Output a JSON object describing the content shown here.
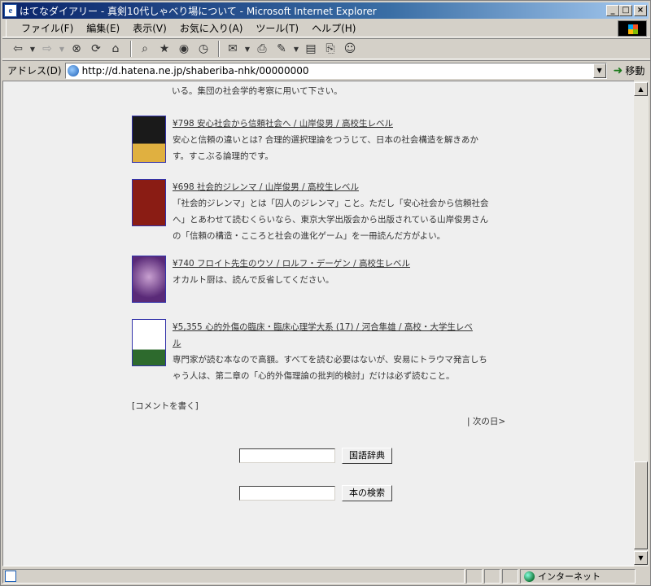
{
  "window": {
    "title": "はてなダイアリー - 真剣10代しゃべり場について - Microsoft Internet Explorer",
    "buttons": {
      "minimize": "_",
      "maximize": "□",
      "close": "×"
    }
  },
  "menu": [
    "ファイル(F)",
    "編集(E)",
    "表示(V)",
    "お気に入り(A)",
    "ツール(T)",
    "ヘルプ(H)"
  ],
  "toolbar": {
    "icons": [
      "back-icon",
      "forward-icon",
      "stop-icon",
      "refresh-icon",
      "home-icon",
      "search-icon",
      "favorites-icon",
      "media-icon",
      "history-icon",
      "mail-icon",
      "print-icon",
      "edit-icon",
      "discuss-icon",
      "messenger-icon"
    ]
  },
  "address": {
    "label": "アドレス(D)",
    "url": "http://d.hatena.ne.jp/shaberiba-nhk/00000000",
    "go_label": "移動"
  },
  "content": {
    "top_tail": "いる。集団の社会学的考察に用いて下さい。",
    "books": [
      {
        "title": "¥798 安心社会から信頼社会へ / 山岸俊男 / 高校生レベル",
        "desc_lines": [
          "安心と信頼の違いとは? 合理的選択理論をつうじて、日本の社会構造を解きあか",
          "す。すこぶる論理的です。"
        ]
      },
      {
        "title": "¥698 社会的ジレンマ / 山岸俊男 / 高校生レベル",
        "desc_lines": [
          "「社会的ジレンマ」とは「囚人のジレンマ」こと。ただし「安心社会から信頼社会",
          "へ」とあわせて読むくらいなら、東京大学出版会から出版されている山岸俊男さん",
          "の「信頼の構造・こころと社会の進化ゲーム」を一冊読んだ方がよい。"
        ]
      },
      {
        "title": "¥740 フロイト先生のウソ / ロルフ・デーゲン / 高校生レベル",
        "desc_lines": [
          "オカルト厨は、読んで反省してください。"
        ]
      },
      {
        "title_lines": [
          "¥5,355 心的外傷の臨床・臨床心理学大系 (17) / 河合隼雄 / 高校・大学生レベ",
          "ル"
        ],
        "desc_lines": [
          "専門家が読む本なので高額。すべてを読む必要はないが、安易にトラウマ発言しち",
          "ゃう人は、第二章の「心的外傷理論の批判的検討」だけは必ず読むこと。"
        ]
      }
    ],
    "comment_link": "[コメントを書く]",
    "next_day": "| 次の日>",
    "search": [
      {
        "button": "国語辞典"
      },
      {
        "button": "本の検索"
      }
    ]
  },
  "status": {
    "zone": "インターネット"
  }
}
